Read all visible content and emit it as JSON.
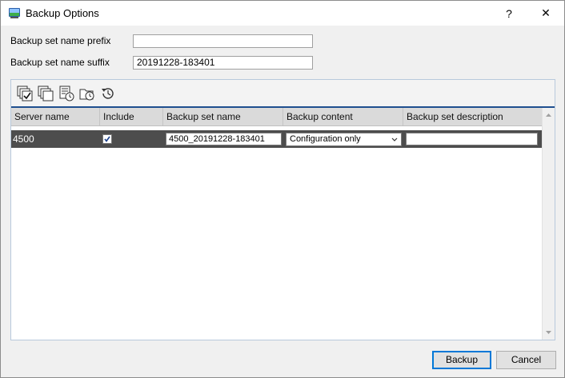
{
  "window": {
    "title": "Backup Options",
    "help": "?",
    "close": "✕"
  },
  "form": {
    "prefix_label": "Backup set name prefix",
    "prefix_value": "",
    "suffix_label": "Backup set name suffix",
    "suffix_value": "20191228-183401"
  },
  "toolbar": {
    "icons": [
      "select-all-icon",
      "deselect-all-icon",
      "schedule-backup-icon",
      "restore-icon",
      "refresh-icon"
    ]
  },
  "table": {
    "columns": [
      "Server name",
      "Include",
      "Backup set name",
      "Backup content",
      "Backup set description"
    ],
    "rows": [
      {
        "server": "4500",
        "include": true,
        "set_name": "4500_20191228-183401",
        "content": "Configuration only",
        "description": ""
      }
    ]
  },
  "buttons": {
    "backup": "Backup",
    "cancel": "Cancel"
  },
  "colors": {
    "selected_row": "#4d4d4d",
    "accent": "#0078d7",
    "header_rule": "#1f4f8f"
  }
}
